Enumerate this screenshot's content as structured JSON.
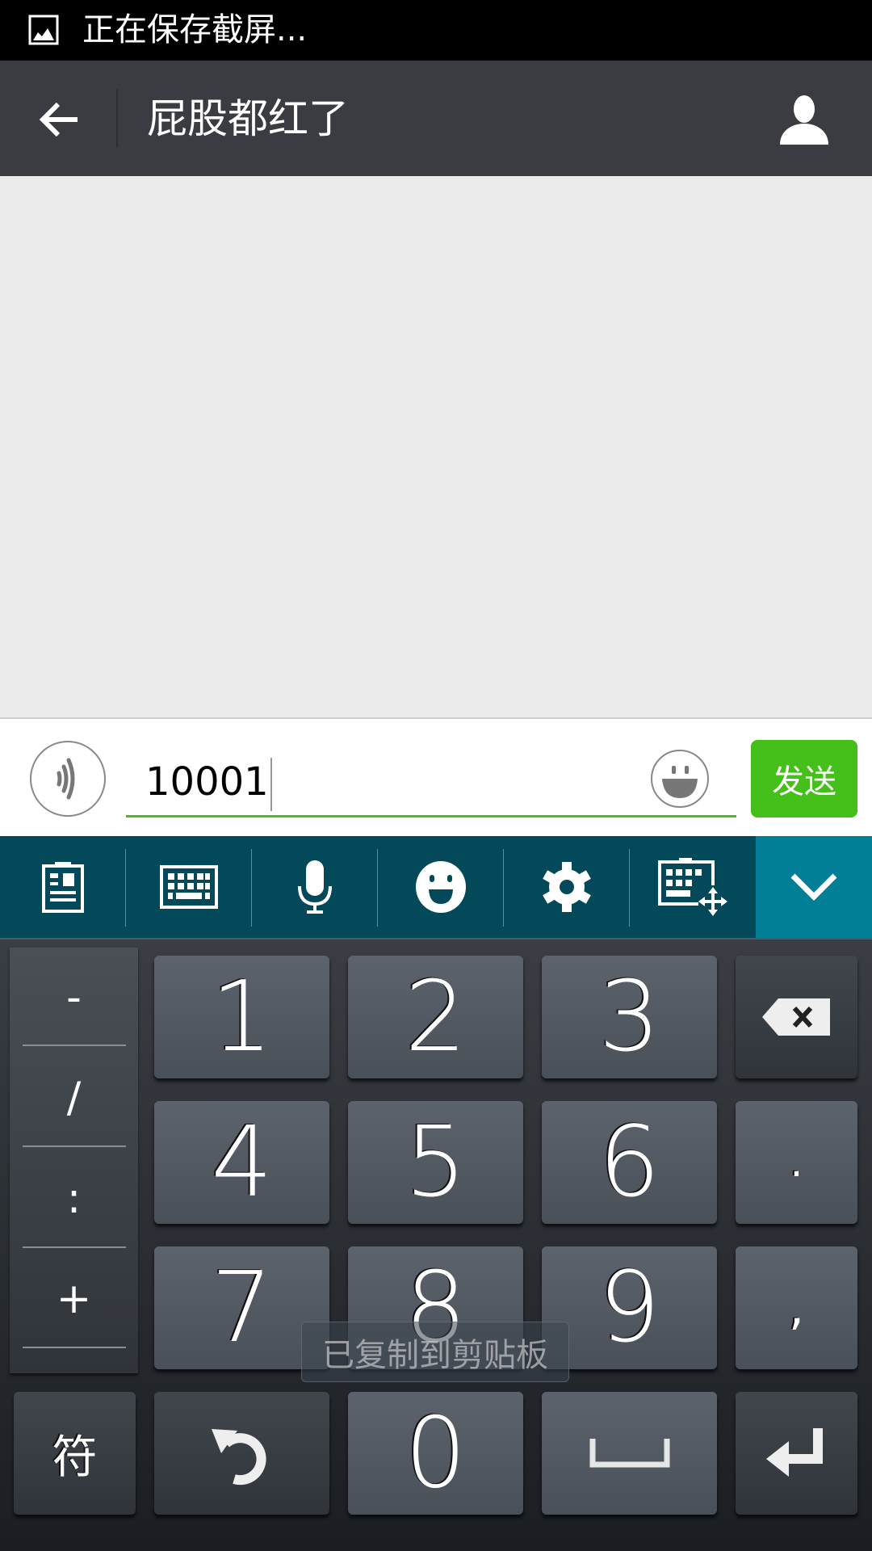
{
  "status_bar": {
    "icon": "image-icon",
    "text": "正在保存截屏..."
  },
  "title_bar": {
    "title": "屁股都红了",
    "back_icon": "arrow-left-icon",
    "profile_icon": "person-icon"
  },
  "input_bar": {
    "value": "10001",
    "send_label": "发送"
  },
  "toolbar": {
    "items": [
      "clipboard-icon",
      "keyboard-icon",
      "microphone-icon",
      "emoji-icon",
      "settings-icon",
      "keyboard-move-icon"
    ],
    "collapse_icon": "chevron-down-icon",
    "accent": "#027f96"
  },
  "keyboard": {
    "side_symbols": [
      "-",
      "/",
      ":",
      "+"
    ],
    "rows": [
      [
        "1",
        "2",
        "3"
      ],
      [
        "4",
        "5",
        "6"
      ],
      [
        "7",
        "8",
        "9"
      ]
    ],
    "right_keys": [
      ".",
      ","
    ],
    "symbols_label": "符",
    "zero": "0"
  },
  "toast": "已复制到剪贴板",
  "colors": {
    "send": "#45c01a",
    "toolbar": "#03495a",
    "header": "#3a3c42"
  }
}
